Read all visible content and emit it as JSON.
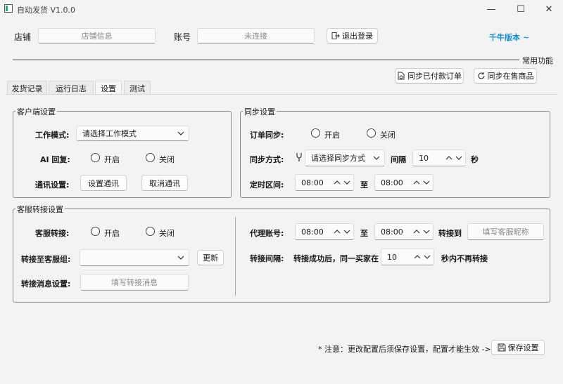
{
  "window": {
    "title": "自动发货 V1.0.0",
    "minimize": "—",
    "maximize": "☐",
    "close": "✕"
  },
  "top": {
    "shop_label": "店铺",
    "shop_placeholder": "店铺信息",
    "account_label": "账号",
    "account_placeholder": "未连接",
    "logout_label": "退出登录",
    "version_label": "千牛版本 ~"
  },
  "common": {
    "title": "常用功能",
    "sync_paid_orders": "同步已付款订单",
    "sync_on_sale": "同步在售商品"
  },
  "tabs": [
    {
      "label": "发货记录",
      "active": false
    },
    {
      "label": "运行日志",
      "active": false
    },
    {
      "label": "设置",
      "active": true
    },
    {
      "label": "测试",
      "active": false
    }
  ],
  "client": {
    "title": "客户端设置",
    "work_mode_label": "工作模式:",
    "work_mode_value": "请选择工作模式",
    "ai_label": "AI 回复:",
    "on": "开启",
    "off": "关闭",
    "comm_label": "通讯设置:",
    "set_comm": "设置通讯",
    "cancel_comm": "取消通讯"
  },
  "sync": {
    "title": "同步设置",
    "order_sync_label": "订单同步:",
    "on": "开启",
    "off": "关闭",
    "method_label": "同步方式:",
    "method_value": "请选择同步方式",
    "interval_label": "间隔",
    "interval_value": "10",
    "interval_unit": "秒",
    "timer_label": "定时区间:",
    "from": "08:00",
    "to_label": "至",
    "to": "08:00"
  },
  "cs": {
    "title": "客服转接设置",
    "transfer_label": "客服转接:",
    "on": "开启",
    "off": "关闭",
    "group_label": "转接至客服组:",
    "group_value": "",
    "refresh": "更新",
    "msg_label": "转接消息设置:",
    "msg_placeholder": "填写转接消息",
    "proxy_label": "代理账号:",
    "proxy_from": "08:00",
    "to_label": "至",
    "proxy_to": "08:00",
    "transfer_to_label": "转接到",
    "nick_placeholder": "填写客服昵称",
    "interval_label": "转接间隔:",
    "interval_prefix": "转接成功后，同一买家在",
    "interval_value": "10",
    "interval_suffix": "秒内不再转接"
  },
  "footer": {
    "notice": "* 注意：更改配置后须保存设置，配置才能生效 ->",
    "save": "保存设置"
  },
  "icons": {
    "logout": "logout-icon",
    "sync_orders": "document-sync-icon",
    "refresh": "refresh-icon",
    "save": "save-icon",
    "wrench": "wrench-icon"
  },
  "colors": {
    "accent": "#0f8fd6",
    "background": "#f3f3f3"
  }
}
